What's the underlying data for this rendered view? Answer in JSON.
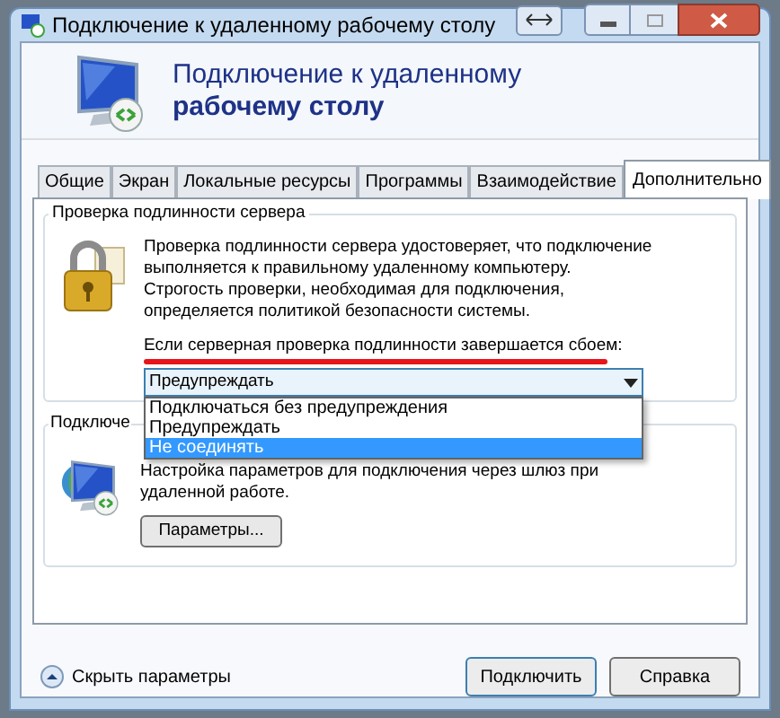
{
  "window": {
    "title": "Подключение к удаленному рабочему столу"
  },
  "header": {
    "line1": "Подключение к удаленному",
    "line2": "рабочему столу"
  },
  "tabs": [
    {
      "label": "Общие",
      "selected": false
    },
    {
      "label": "Экран",
      "selected": false
    },
    {
      "label": "Локальные ресурсы",
      "selected": false
    },
    {
      "label": "Программы",
      "selected": false
    },
    {
      "label": "Взаимодействие",
      "selected": false
    },
    {
      "label": "Дополнительно",
      "selected": true
    }
  ],
  "server_auth": {
    "label": "Проверка подлинности сервера",
    "description": "Проверка подлинности сервера удостоверяет, что подключение\nвыполняется к правильному удаленному компьютеру.\nСтрогость проверки, необходимая для подключения,\nопределяется политикой безопасности системы.",
    "prompt": "Если серверная проверка подлинности завершается сбоем:",
    "dropdown": {
      "value": "Предупреждать",
      "expanded": true,
      "options": [
        {
          "label": "Подключаться без предупреждения",
          "highlighted": false
        },
        {
          "label": "Предупреждать",
          "highlighted": false
        },
        {
          "label": "Не соединять",
          "highlighted": true
        }
      ]
    }
  },
  "gateway": {
    "label": "Подключе",
    "description": "Настройка параметров для подключения через шлюз при\nудаленной работе.",
    "button": "Параметры..."
  },
  "footer": {
    "toggle": "Скрыть параметры",
    "buttons": [
      "Подключить",
      "Справка"
    ]
  }
}
